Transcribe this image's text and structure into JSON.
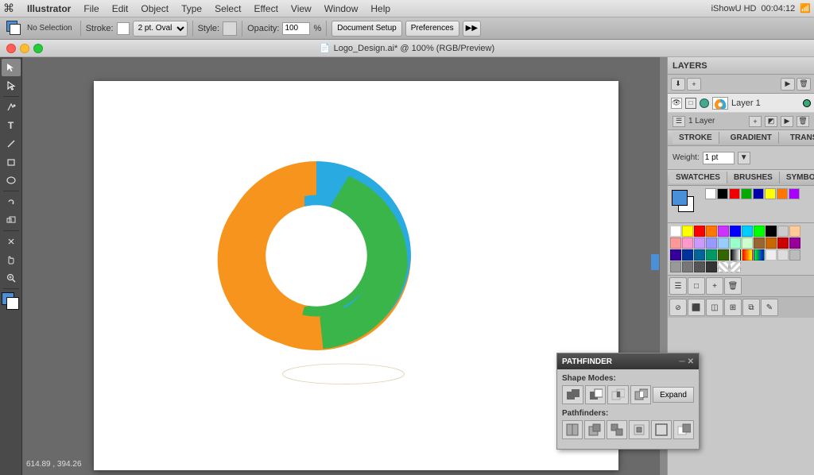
{
  "menubar": {
    "apple": "⌘",
    "items": [
      "Illustrator",
      "File",
      "Edit",
      "Object",
      "Type",
      "Select",
      "Effect",
      "View",
      "Window",
      "Help"
    ],
    "time": "00:04:12",
    "screen": "iShowU HD"
  },
  "toolbar": {
    "no_selection_label": "No Selection",
    "stroke_label": "Stroke:",
    "stroke_value": "",
    "stroke_width": "2 pt.",
    "stroke_type": "Oval",
    "style_label": "Style:",
    "opacity_label": "Opacity:",
    "opacity_value": "100",
    "doc_setup_label": "Document Setup",
    "prefs_label": "Preferences"
  },
  "titlebar": {
    "title": "Logo_Design.ai* @ 100% (RGB/Preview)"
  },
  "layers": {
    "panel_title": "LAYERS",
    "layer1": "Layer 1",
    "layer_count": "1 Layer"
  },
  "stroke": {
    "panel_title": "STROKE",
    "gradient_tab": "GRADIENT",
    "transparency_tab": "TRANSPAR...",
    "weight_label": "Weight:"
  },
  "swatches": {
    "panel_title": "SWATCHES",
    "brushes_tab": "BRUSHES",
    "symbols_tab": "SYMBOLS",
    "colors": [
      "#ffffff",
      "#ffff00",
      "#ff0000",
      "#ff6600",
      "#cc33ff",
      "#0000ff",
      "#00ccff",
      "#00ff00",
      "#000000",
      "#cccccc",
      "#ffcc99",
      "#ff9999",
      "#ff99cc",
      "#cc99ff",
      "#9999ff",
      "#99ccff",
      "#99ffcc",
      "#ccffcc",
      "#996633",
      "#cc6600",
      "#cc0000",
      "#990099",
      "#330099",
      "#003399",
      "#006699",
      "#009966",
      "#336600",
      "#f5a623",
      "#e8e8e8",
      "#d0d0d0",
      "#b8b8b8",
      "#a0a0a0",
      "#888888",
      "#666666",
      "#444444",
      "#222222"
    ]
  },
  "pathfinder": {
    "title": "PATHFINDER",
    "shape_modes_label": "Shape Modes:",
    "pathfinders_label": "Pathfinders:",
    "expand_label": "Expand",
    "mode_icons": [
      "unite",
      "minus-front",
      "intersect",
      "exclude"
    ],
    "pf_icons": [
      "divide",
      "trim",
      "merge",
      "crop",
      "outline",
      "minus-back"
    ]
  },
  "logo": {
    "orange_color": "#F7941D",
    "green_color": "#39B54A",
    "blue_color": "#29ABE2"
  },
  "tools": {
    "items": [
      "↖",
      "↖",
      "✏",
      "✒",
      "∿",
      "⬚",
      "⬡",
      "□",
      "◯",
      "⊗",
      "✂",
      "↔",
      "⊞",
      "✊",
      "🔍",
      "▼",
      "⬟"
    ]
  }
}
